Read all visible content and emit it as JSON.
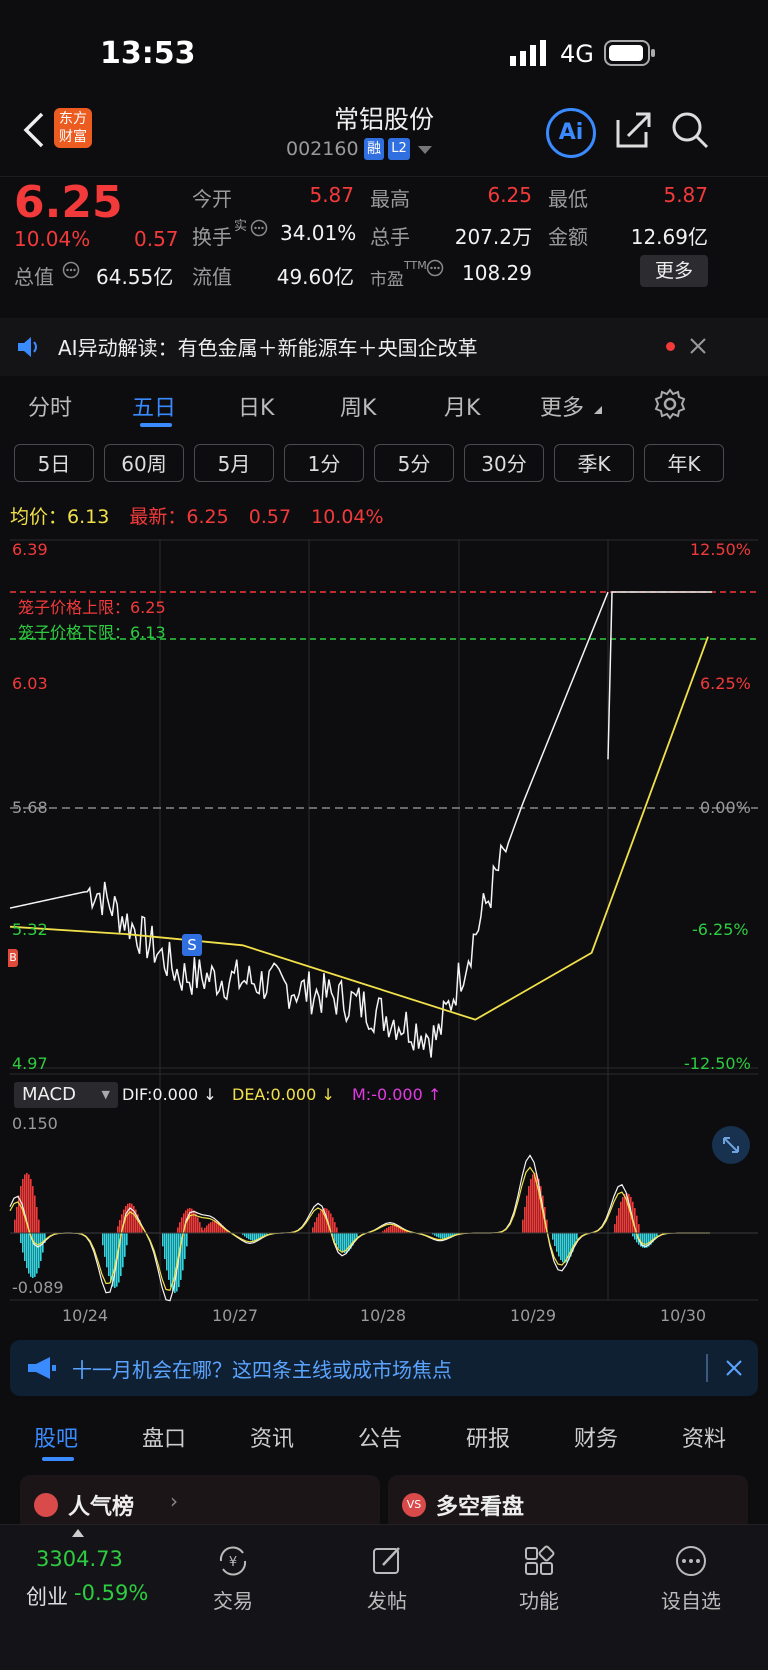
{
  "status": {
    "time": "13:53",
    "network": "4G"
  },
  "header": {
    "logo_text_line1": "东方",
    "logo_text_line2": "财富",
    "title": "常铝股份",
    "code": "002160",
    "badge_rong": "融",
    "badge_l2": "L2",
    "ai_label": "Ai"
  },
  "quote": {
    "price": "6.25",
    "change_pct": "10.04%",
    "change_abs": "0.57",
    "open_label": "今开",
    "open": "5.87",
    "high_label": "最高",
    "high": "6.25",
    "low_label": "最低",
    "low": "5.87",
    "turnover_label": "换手",
    "turnover_sup": "实",
    "turnover": "34.01%",
    "volume_label": "总手",
    "volume": "207.2万",
    "amount_label": "金额",
    "amount": "12.69亿",
    "mktcap_label": "总值",
    "mktcap": "64.55亿",
    "float_label": "流值",
    "float": "49.60亿",
    "pe_label": "市盈",
    "pe_sup": "TTM",
    "pe": "108.29",
    "more_label": "更多"
  },
  "ai_bar": {
    "text": "AI异动解读：有色金属＋新能源车＋央国企改革"
  },
  "tabs": [
    "分时",
    "五日",
    "日K",
    "周K",
    "月K",
    "更多"
  ],
  "active_tab": 1,
  "periods": [
    "5日",
    "60周",
    "5月",
    "1分",
    "5分",
    "30分",
    "季K",
    "年K"
  ],
  "avg_line": {
    "avg_label": "均价：",
    "avg": "6.13",
    "last_label": "最新：",
    "last": "6.25",
    "chg": "0.57",
    "pct": "10.04%"
  },
  "chart": {
    "y_left": [
      "6.39",
      "6.03",
      "5.68",
      "5.32",
      "4.97"
    ],
    "y_right": [
      "12.50%",
      "6.25%",
      "0.00%",
      "-6.25%",
      "-12.50%"
    ],
    "upper_limit_label": "笼子价格上限：6.25",
    "lower_limit_label": "笼子价格下限：6.13",
    "marker_s": "S",
    "marker_b": "B",
    "dates": [
      "10/24",
      "10/27",
      "10/28",
      "10/29",
      "10/30"
    ]
  },
  "chart_data": {
    "type": "line",
    "title": "",
    "xlabel": "",
    "ylabel": "",
    "x": [
      "10/24",
      "10/27",
      "10/28",
      "10/29",
      "10/30"
    ],
    "ylim": [
      4.97,
      6.39
    ],
    "series": [
      {
        "values": [
          5.4,
          5.45,
          5.22,
          5.2,
          5.15,
          5.05,
          5.68,
          6.25
        ]
      },
      {
        "values": [
          5.35,
          5.33,
          5.3,
          5.2,
          5.1,
          5.28,
          6.13
        ]
      }
    ]
  },
  "macd": {
    "selector": "MACD",
    "dif": "DIF:0.000 ↓",
    "dea": "DEA:0.000 ↓",
    "m": "M:-0.000 ↑",
    "max": "0.150",
    "min": "-0.089"
  },
  "banner": {
    "text": "十一月机会在哪？这四条主线或成市场焦点"
  },
  "subtabs": [
    "股吧",
    "盘口",
    "资讯",
    "公告",
    "研报",
    "财务",
    "资料"
  ],
  "active_subtab": 0,
  "cards": {
    "left": "人气榜",
    "right": "多空看盘"
  },
  "bottom": {
    "index_value": "3304.73",
    "index_name": "创业",
    "index_change": "-0.59%",
    "nav": [
      "交易",
      "发帖",
      "功能",
      "设自选"
    ]
  },
  "colors": {
    "up": "#f23a3a",
    "down": "#2ecc40",
    "accent": "#3a8bff",
    "avg": "#f1e04a"
  }
}
